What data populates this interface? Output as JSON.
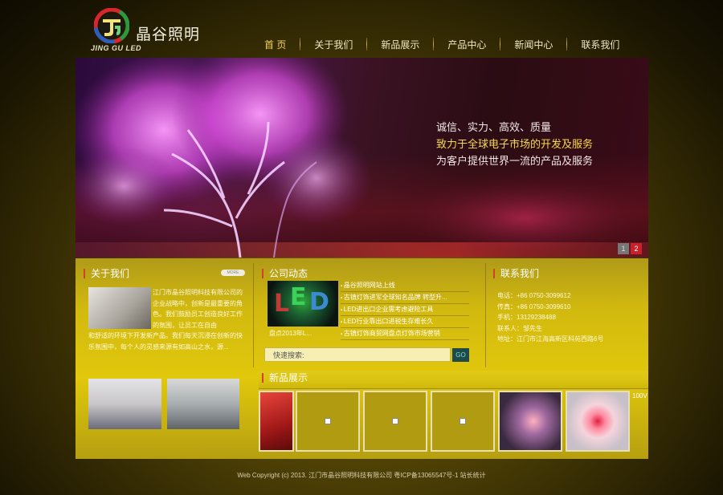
{
  "header": {
    "logo_cn": "晶谷照明",
    "logo_en": "JING GU LED"
  },
  "nav": {
    "items": [
      {
        "label": "首 页",
        "active": true
      },
      {
        "label": "关于我们",
        "active": false
      },
      {
        "label": "新品展示",
        "active": false
      },
      {
        "label": "产品中心",
        "active": false
      },
      {
        "label": "新闻中心",
        "active": false
      },
      {
        "label": "联系我们",
        "active": false
      }
    ]
  },
  "banner": {
    "line1": "诚信、实力、高效、质量",
    "line2": "致力于全球电子市场的开发及服务",
    "line3": "为客户提供世界一流的产品及服务",
    "pager": [
      "1",
      "2"
    ],
    "active_page": 2
  },
  "about": {
    "title": "关于我们",
    "more": "MORE",
    "text_side": "江门市晶谷照明科技有限公司的企业战略中，创新是最重要的角色。我们鼓励员工创造良好工作的氛围，让员工在自由",
    "text_full": "和舒适的环境下开发新产品。我们每天沉浸在创新的快乐氛围中，每个人的灵感来源有如高山之水，源..."
  },
  "news": {
    "title": "公司动态",
    "image_caption": "盘点2013年L...",
    "items": [
      "晶谷照明网站上线",
      "古镇灯饰进军全球知名品牌 转型升...",
      "LED进出口企业需考虑避险工具",
      "LED行业靠出口进税生存难长久",
      "古镇灯饰商贸网盘点灯饰市场营销"
    ],
    "search_label": "快速搜索:",
    "search_button": "GO"
  },
  "contact": {
    "title": "联系我们",
    "lines": [
      "电话：+86 0750-3099612",
      "传真：+86 0750-3099610",
      "手机：13129238488",
      "联系人：邹先生",
      "地址：江门市江海高新区科苑西路6号"
    ]
  },
  "products": {
    "title": "新品展示",
    "overflow_label": "100V"
  },
  "footer": {
    "text": "Web Copyright (c) 2013. 江门市晶谷照明科技有限公司   粤ICP备13065547号-1   站长统计"
  },
  "colors": {
    "accent_red": "#d2402c",
    "nav_active": "#f7d45a",
    "panel_gold": "#d2b90f"
  }
}
